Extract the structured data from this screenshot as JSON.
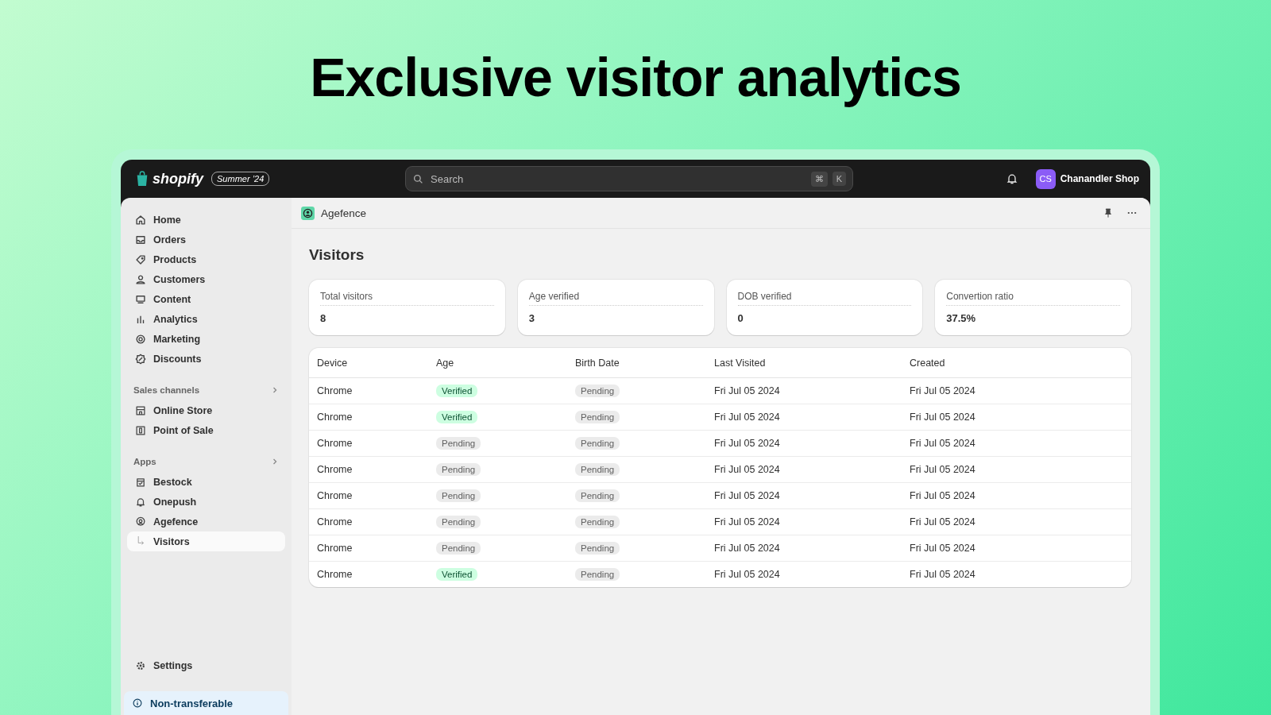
{
  "headline": "Exclusive visitor analytics",
  "topbar": {
    "logo": "shopify",
    "edition": "Summer ’24",
    "search": {
      "placeholder": "Search",
      "keys": [
        "⌘",
        "K"
      ]
    },
    "account": {
      "initials": "CS",
      "name": "Chanandler Shop"
    }
  },
  "sidebar": {
    "main": [
      {
        "label": "Home",
        "selected": false
      },
      {
        "label": "Orders",
        "selected": false
      },
      {
        "label": "Products",
        "selected": false
      },
      {
        "label": "Customers",
        "selected": false
      },
      {
        "label": "Content",
        "selected": false
      },
      {
        "label": "Analytics",
        "selected": false
      },
      {
        "label": "Marketing",
        "selected": false
      },
      {
        "label": "Discounts",
        "selected": false
      }
    ],
    "sales_channels": {
      "title": "Sales channels",
      "items": [
        {
          "label": "Online Store",
          "selected": false
        },
        {
          "label": "Point of Sale",
          "selected": false
        }
      ]
    },
    "apps": {
      "title": "Apps",
      "items": [
        {
          "label": "Bestock",
          "selected": false
        },
        {
          "label": "Onepush",
          "selected": false
        },
        {
          "label": "Agefence",
          "selected": false,
          "children": [
            {
              "label": "Visitors",
              "selected": true
            }
          ]
        }
      ]
    },
    "settings": "Settings",
    "notice": "Non-transferable"
  },
  "app_header": {
    "title": "Agefence"
  },
  "page_title": "Visitors",
  "stats": [
    {
      "label": "Total visitors",
      "value": "8"
    },
    {
      "label": "Age verified",
      "value": "3"
    },
    {
      "label": "DOB verified",
      "value": "0"
    },
    {
      "label": "Convertion ratio",
      "value": "37.5%"
    }
  ],
  "table": {
    "columns": [
      "Device",
      "Age",
      "Birth Date",
      "Last Visited",
      "Created"
    ],
    "rows": [
      {
        "device": "Chrome",
        "age": {
          "text": "Verified",
          "kind": "success"
        },
        "birth_date": {
          "text": "Pending",
          "kind": "pending"
        },
        "last_visited": "Fri Jul 05 2024",
        "created": "Fri Jul 05 2024"
      },
      {
        "device": "Chrome",
        "age": {
          "text": "Verified",
          "kind": "success"
        },
        "birth_date": {
          "text": "Pending",
          "kind": "pending"
        },
        "last_visited": "Fri Jul 05 2024",
        "created": "Fri Jul 05 2024"
      },
      {
        "device": "Chrome",
        "age": {
          "text": "Pending",
          "kind": "pending"
        },
        "birth_date": {
          "text": "Pending",
          "kind": "pending"
        },
        "last_visited": "Fri Jul 05 2024",
        "created": "Fri Jul 05 2024"
      },
      {
        "device": "Chrome",
        "age": {
          "text": "Pending",
          "kind": "pending"
        },
        "birth_date": {
          "text": "Pending",
          "kind": "pending"
        },
        "last_visited": "Fri Jul 05 2024",
        "created": "Fri Jul 05 2024"
      },
      {
        "device": "Chrome",
        "age": {
          "text": "Pending",
          "kind": "pending"
        },
        "birth_date": {
          "text": "Pending",
          "kind": "pending"
        },
        "last_visited": "Fri Jul 05 2024",
        "created": "Fri Jul 05 2024"
      },
      {
        "device": "Chrome",
        "age": {
          "text": "Pending",
          "kind": "pending"
        },
        "birth_date": {
          "text": "Pending",
          "kind": "pending"
        },
        "last_visited": "Fri Jul 05 2024",
        "created": "Fri Jul 05 2024"
      },
      {
        "device": "Chrome",
        "age": {
          "text": "Pending",
          "kind": "pending"
        },
        "birth_date": {
          "text": "Pending",
          "kind": "pending"
        },
        "last_visited": "Fri Jul 05 2024",
        "created": "Fri Jul 05 2024"
      },
      {
        "device": "Chrome",
        "age": {
          "text": "Verified",
          "kind": "success"
        },
        "birth_date": {
          "text": "Pending",
          "kind": "pending"
        },
        "last_visited": "Fri Jul 05 2024",
        "created": "Fri Jul 05 2024"
      }
    ]
  }
}
